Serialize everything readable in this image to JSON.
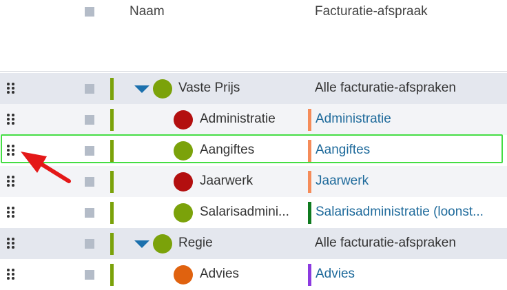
{
  "header": {
    "name_label": "Naam",
    "billing_label": "Facturatie-afspraak"
  },
  "colors": {
    "status_green": "#7ba20a",
    "status_red": "#b30f0f",
    "status_orange": "#e0620f",
    "bar_salmon": "#f58c5a",
    "bar_darkgreen": "#0f7a1f",
    "bar_purple": "#8c3ae0",
    "link_blue": "#1e6a9b",
    "caret_blue": "#1b70ad",
    "highlight_green": "#44dd44",
    "arrow_red": "#e41818"
  },
  "rows": [
    {
      "kind": "group",
      "label": "Vaste Prijs",
      "status_color": "#7ba20a",
      "billing": "Alle facturatie-afspraken"
    },
    {
      "kind": "item",
      "label": "Administratie",
      "status_color": "#b30f0f",
      "billing": "Administratie",
      "billing_bar_color": "#f58c5a"
    },
    {
      "kind": "item",
      "label": "Aangiftes",
      "status_color": "#7ba20a",
      "billing": "Aangiftes",
      "billing_bar_color": "#f58c5a",
      "highlighted": true
    },
    {
      "kind": "item",
      "label": "Jaarwerk",
      "status_color": "#b30f0f",
      "billing": "Jaarwerk",
      "billing_bar_color": "#f58c5a"
    },
    {
      "kind": "item",
      "label": "Salarisadmini...",
      "status_color": "#7ba20a",
      "billing": "Salarisadministratie (loonst...",
      "billing_bar_color": "#0f7a1f"
    },
    {
      "kind": "group",
      "label": "Regie",
      "status_color": "#7ba20a",
      "billing": "Alle facturatie-afspraken"
    },
    {
      "kind": "item",
      "label": "Advies",
      "status_color": "#e0620f",
      "billing": "Advies",
      "billing_bar_color": "#8c3ae0"
    }
  ]
}
